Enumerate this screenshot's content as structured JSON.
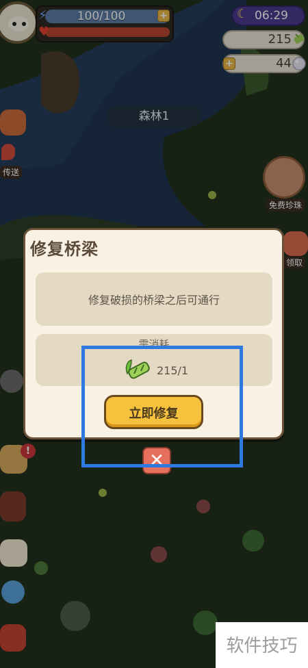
{
  "hud": {
    "energy_text": "100/100",
    "clock_text": "06:29",
    "resource_1_value": "215",
    "resource_2_value": "44"
  },
  "map": {
    "area_label": "森林1",
    "teleport_label": "传送",
    "free_pearl_label": "免费珍珠",
    "claim_label": "领取",
    "alert_badge": "!"
  },
  "dialog": {
    "title": "修复桥梁",
    "description": "修复破损的桥梁之后可通行",
    "cost_title": "需消耗",
    "cost_icon": "bamboo-icon",
    "cost_value": "215/1",
    "repair_button": "立即修复",
    "close_symbol": "✕"
  },
  "watermark": {
    "text": "软件技巧"
  },
  "colors": {
    "highlight": "#2f7ae0",
    "button_yellow": "#f6c23d",
    "dialog_bg": "#f9f2e4"
  }
}
